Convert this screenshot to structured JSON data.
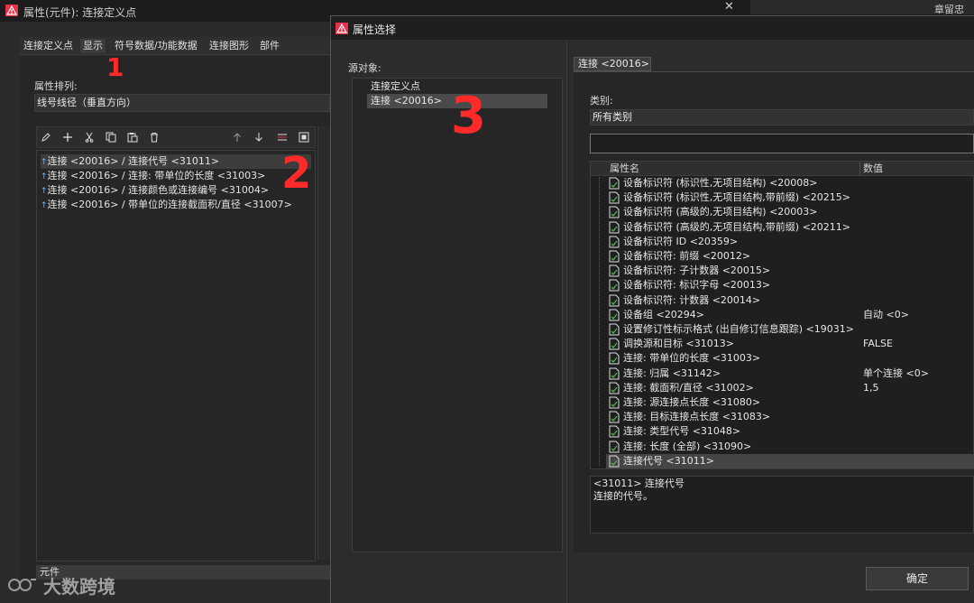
{
  "main_window": {
    "title": "属性(元件): 连接定义点",
    "close_glyph": "✕",
    "user": "章留忠",
    "tabs": [
      "连接定义点",
      "显示",
      "符号数据/功能数据",
      "连接图形",
      "部件"
    ],
    "active_tab": "显示",
    "sort_label": "属性排列:",
    "sort_value": "线号线径（垂直方向）",
    "list_items": [
      "连接 <20016> / 连接代号 <31011>",
      "连接 <20016> / 连接: 带单位的长度 <31003>",
      "连接 <20016> / 连接颜色或连接编号 <31004>",
      "连接 <20016> / 带单位的连接截面积/直径 <31007>"
    ],
    "status_tab": "元件"
  },
  "dialog": {
    "title": "属性选择",
    "source_label": "源对象:",
    "source_items": [
      "连接定义点",
      "连接 <20016>"
    ],
    "breadcrumb": "连接 <20016>",
    "category_label": "类别:",
    "category_value": "所有类别",
    "search_value": "",
    "table_headers": [
      "属性名",
      "数值"
    ],
    "properties": [
      {
        "name": "设备标识符 (标识性,无项目结构) <20008>",
        "value": ""
      },
      {
        "name": "设备标识符 (标识性,无项目结构,带前缀) <20215>",
        "value": ""
      },
      {
        "name": "设备标识符 (高级的,无项目结构) <20003>",
        "value": ""
      },
      {
        "name": "设备标识符 (高级的,无项目结构,带前缀) <20211>",
        "value": ""
      },
      {
        "name": "设备标识符 ID <20359>",
        "value": ""
      },
      {
        "name": "设备标识符: 前缀 <20012>",
        "value": ""
      },
      {
        "name": "设备标识符: 子计数器 <20015>",
        "value": ""
      },
      {
        "name": "设备标识符: 标识字母 <20013>",
        "value": ""
      },
      {
        "name": "设备标识符: 计数器 <20014>",
        "value": ""
      },
      {
        "name": "设备组 <20294>",
        "value": "自动 <0>"
      },
      {
        "name": "设置修订性标示格式 (出自修订信息跟踪) <19031>",
        "value": ""
      },
      {
        "name": "调换源和目标 <31013>",
        "value": "FALSE"
      },
      {
        "name": "连接: 带单位的长度 <31003>",
        "value": ""
      },
      {
        "name": "连接: 归属 <31142>",
        "value": "单个连接 <0>"
      },
      {
        "name": "连接: 截面积/直径 <31002>",
        "value": "1,5"
      },
      {
        "name": "连接: 源连接点长度 <31080>",
        "value": ""
      },
      {
        "name": "连接: 目标连接点长度 <31083>",
        "value": ""
      },
      {
        "name": "连接: 类型代号 <31048>",
        "value": ""
      },
      {
        "name": "连接: 长度 (全部) <31090>",
        "value": ""
      },
      {
        "name": "连接代号 <31011>",
        "value": ""
      }
    ],
    "selected_property": "连接代号 <31011>",
    "description_line1": "<31011> 连接代号",
    "description_line2": "连接的代号。",
    "ok_label": "确定"
  },
  "annotations": [
    "1",
    "2",
    "3"
  ],
  "watermark": "大数跨境",
  "colors": {
    "accent_red": "#ff2a2a",
    "app_icon_red": "#e8304a",
    "selection": "#454545"
  },
  "toolbar_icons": [
    "pencil-icon",
    "plus-icon",
    "scissors-icon",
    "copy-icon",
    "paste-icon",
    "trash-icon",
    "arrow-up-icon",
    "arrow-down-icon",
    "swap-icon",
    "box-icon"
  ]
}
